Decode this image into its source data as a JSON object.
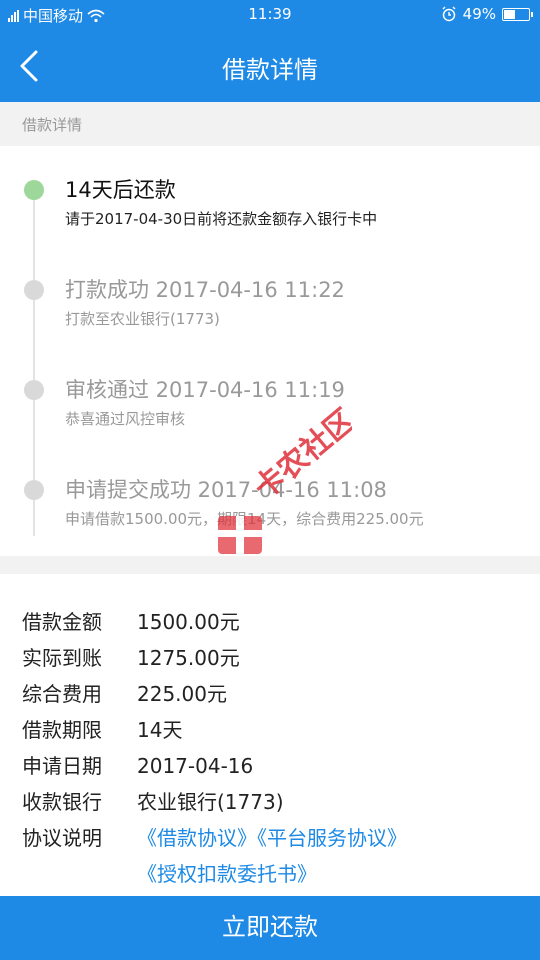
{
  "status_bar": {
    "carrier": "中国移动",
    "time": "11:39",
    "battery_text": "49%",
    "battery_level": 0.49
  },
  "nav": {
    "title": "借款详情"
  },
  "section_header": "借款详情",
  "timeline": [
    {
      "title": "14天后还款",
      "subtitle": "请于2017-04-30日前将还款金额存入银行卡中",
      "active": true
    },
    {
      "title": "打款成功 2017-04-16 11:22",
      "subtitle": "打款至农业银行(1773)",
      "active": false
    },
    {
      "title": "审核通过 2017-04-16 11:19",
      "subtitle": "恭喜通过风控审核",
      "active": false
    },
    {
      "title": "申请提交成功 2017-04-16 11:08",
      "subtitle": "申请借款1500.00元，期限14天，综合费用225.00元",
      "active": false
    }
  ],
  "details": {
    "amount_label": "借款金额",
    "amount_value": "1500.00元",
    "received_label": "实际到账",
    "received_value": "1275.00元",
    "fee_label": "综合费用",
    "fee_value": "225.00元",
    "term_label": "借款期限",
    "term_value": "14天",
    "date_label": "申请日期",
    "date_value": "2017-04-16",
    "bank_label": "收款银行",
    "bank_value": "农业银行(1773)",
    "agreement_label": "协议说明",
    "agreement_link_1": "《借款协议》",
    "agreement_link_2": "《平台服务协议》",
    "agreement_link_3": "《授权扣款委托书》"
  },
  "watermark_text": "卡农社区",
  "bottom_button": "立即还款",
  "colors": {
    "primary": "#1e8ae6",
    "active_dot": "#9ed79a",
    "inactive_dot": "#d9d9d9",
    "watermark": "#e0303a"
  }
}
